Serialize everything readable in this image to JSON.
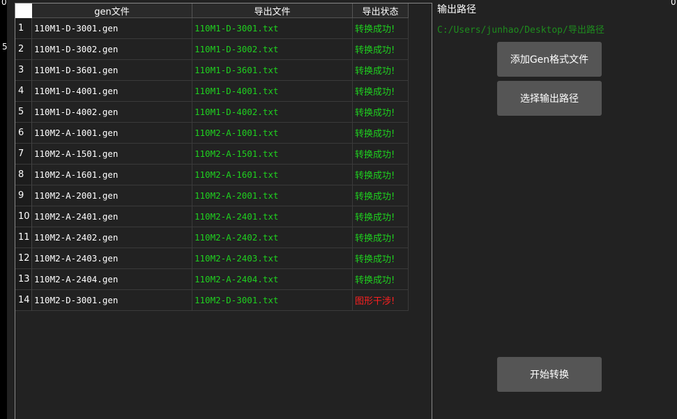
{
  "edge": {
    "left_mark": "5",
    "right_mark": "0",
    "top_left_mark": "0"
  },
  "table": {
    "headers": {
      "gen": "gen文件",
      "out": "导出文件",
      "status": "导出状态"
    },
    "rows": [
      {
        "num": "1",
        "gen": "110M1-D-3001.gen",
        "out": "110M1-D-3001.txt",
        "status": "转换成功!",
        "ok": true
      },
      {
        "num": "2",
        "gen": "110M1-D-3002.gen",
        "out": "110M1-D-3002.txt",
        "status": "转换成功!",
        "ok": true
      },
      {
        "num": "3",
        "gen": "110M1-D-3601.gen",
        "out": "110M1-D-3601.txt",
        "status": "转换成功!",
        "ok": true
      },
      {
        "num": "4",
        "gen": "110M1-D-4001.gen",
        "out": "110M1-D-4001.txt",
        "status": "转换成功!",
        "ok": true
      },
      {
        "num": "5",
        "gen": "110M1-D-4002.gen",
        "out": "110M1-D-4002.txt",
        "status": "转换成功!",
        "ok": true
      },
      {
        "num": "6",
        "gen": "110M2-A-1001.gen",
        "out": "110M2-A-1001.txt",
        "status": "转换成功!",
        "ok": true
      },
      {
        "num": "7",
        "gen": "110M2-A-1501.gen",
        "out": "110M2-A-1501.txt",
        "status": "转换成功!",
        "ok": true
      },
      {
        "num": "8",
        "gen": "110M2-A-1601.gen",
        "out": "110M2-A-1601.txt",
        "status": "转换成功!",
        "ok": true
      },
      {
        "num": "9",
        "gen": "110M2-A-2001.gen",
        "out": "110M2-A-2001.txt",
        "status": "转换成功!",
        "ok": true
      },
      {
        "num": "10",
        "gen": "110M2-A-2401.gen",
        "out": "110M2-A-2401.txt",
        "status": "转换成功!",
        "ok": true
      },
      {
        "num": "11",
        "gen": "110M2-A-2402.gen",
        "out": "110M2-A-2402.txt",
        "status": "转换成功!",
        "ok": true
      },
      {
        "num": "12",
        "gen": "110M2-A-2403.gen",
        "out": "110M2-A-2403.txt",
        "status": "转换成功!",
        "ok": true
      },
      {
        "num": "13",
        "gen": "110M2-A-2404.gen",
        "out": "110M2-A-2404.txt",
        "status": "转换成功!",
        "ok": true
      },
      {
        "num": "14",
        "gen": "110M2-D-3001.gen",
        "out": "110M2-D-3001.txt",
        "status": "图形干涉!",
        "ok": false
      }
    ]
  },
  "side": {
    "output_label": "输出路径",
    "output_path": "C:/Users/junhao/Desktop/导出路径",
    "add_button": "添加Gen格式文件",
    "select_button": "选择输出路径",
    "start_button": "开始转换"
  },
  "colors": {
    "success": "#1fd01f",
    "error": "#ff2020",
    "path": "#1e8c1e"
  }
}
